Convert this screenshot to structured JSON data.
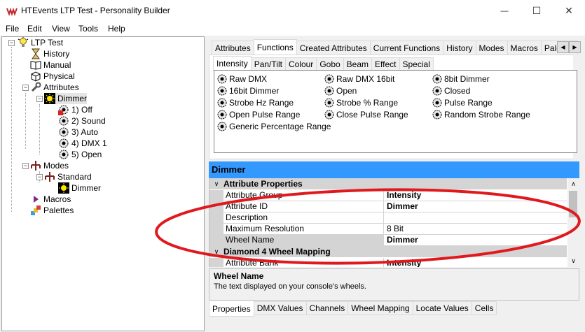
{
  "window": {
    "title": "HTEvents LTP Test - Personality Builder",
    "minimize_glyph": "—",
    "maximize_glyph": "☐",
    "close_glyph": "✕"
  },
  "menu": [
    "File",
    "Edit",
    "View",
    "Tools",
    "Help"
  ],
  "tree": {
    "root": "LTP Test",
    "history": "History",
    "manual": "Manual",
    "physical": "Physical",
    "attributes": "Attributes",
    "dimmer": "Dimmer",
    "functions": [
      "1) Off",
      "2) Sound",
      "3) Auto",
      "4) DMX 1",
      "5) Open"
    ],
    "modes": "Modes",
    "standard": "Standard",
    "mode_dimmer": "Dimmer",
    "macros": "Macros",
    "palettes": "Palettes"
  },
  "top_tabs": [
    "Attributes",
    "Functions",
    "Created Attributes",
    "Current Functions",
    "History",
    "Modes",
    "Macros",
    "Palettes"
  ],
  "top_tabs_active": "Functions",
  "sub_tabs": [
    "Intensity",
    "Pan/Tilt",
    "Colour",
    "Gobo",
    "Beam",
    "Effect",
    "Special"
  ],
  "sub_tabs_active": "Intensity",
  "function_items": {
    "col1": [
      "Raw DMX",
      "16bit Dimmer",
      "Strobe Hz Range",
      "Open Pulse Range",
      "Generic Percentage Range"
    ],
    "col2": [
      "Raw DMX 16bit",
      "Open",
      "Strobe % Range",
      "Close Pulse Range"
    ],
    "col3": [
      "8bit Dimmer",
      "Closed",
      "Pulse Range",
      "Random Strobe Range"
    ]
  },
  "property_grid": {
    "header": "Dimmer",
    "cat1": "Attribute Properties",
    "rows": [
      {
        "name": "Attribute Group",
        "value": "Intensity"
      },
      {
        "name": "Attribute ID",
        "value": "Dimmer"
      },
      {
        "name": "Description",
        "value": ""
      },
      {
        "name": "Maximum Resolution",
        "value": "8 Bit"
      },
      {
        "name": "Wheel Name",
        "value": "Dimmer"
      }
    ],
    "cat2": "Diamond 4 Wheel Mapping",
    "rows2": [
      {
        "name": "Attribute Bank",
        "value": "Intensity"
      }
    ],
    "desc_title": "Wheel Name",
    "desc_text": "The text displayed on your console's wheels."
  },
  "bottom_tabs": [
    "Properties",
    "DMX Values",
    "Channels",
    "Wheel Mapping",
    "Locate Values",
    "Cells"
  ],
  "bottom_tabs_active": "Properties",
  "annotation_color": "#e0191e",
  "selection_color": "#3399ff"
}
